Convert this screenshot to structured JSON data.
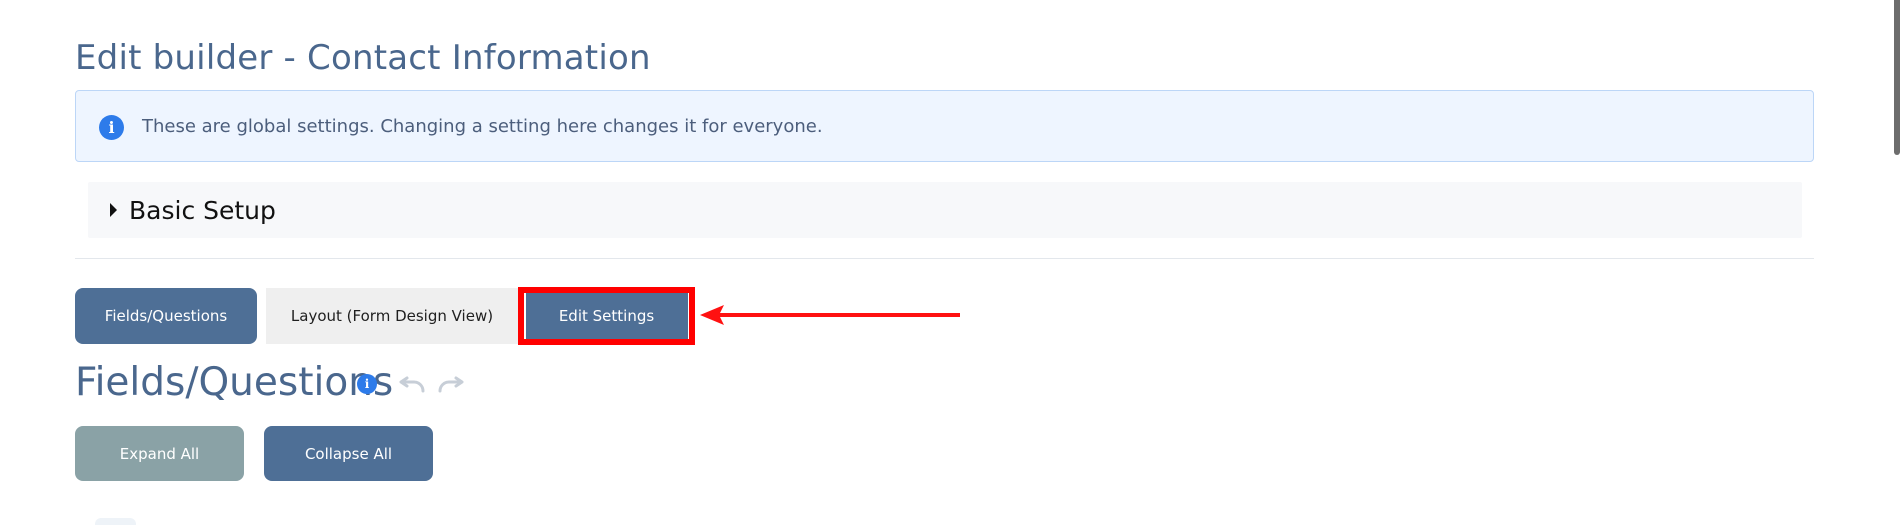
{
  "header": {
    "title": "Edit builder - Contact Information"
  },
  "banner": {
    "icon": "info-icon",
    "text": "These are global settings. Changing a setting here changes it for everyone."
  },
  "basic_setup": {
    "label": "Basic Setup",
    "icon": "caret-right-icon"
  },
  "tabs": [
    {
      "label": "Fields/Questions"
    },
    {
      "label": "Layout (Form Design View)"
    },
    {
      "label": "Edit Settings"
    }
  ],
  "section": {
    "title": "Fields/Questions",
    "help_icon": "info-icon",
    "undo_icon": "undo-icon",
    "redo_icon": "redo-icon"
  },
  "actions": {
    "expand_label": "Expand All",
    "collapse_label": "Collapse All"
  },
  "colors": {
    "primary": "#4e6f96",
    "info_blue": "#2d7bea",
    "highlight": "#ff0000",
    "muted_button": "#8aa2a6"
  }
}
